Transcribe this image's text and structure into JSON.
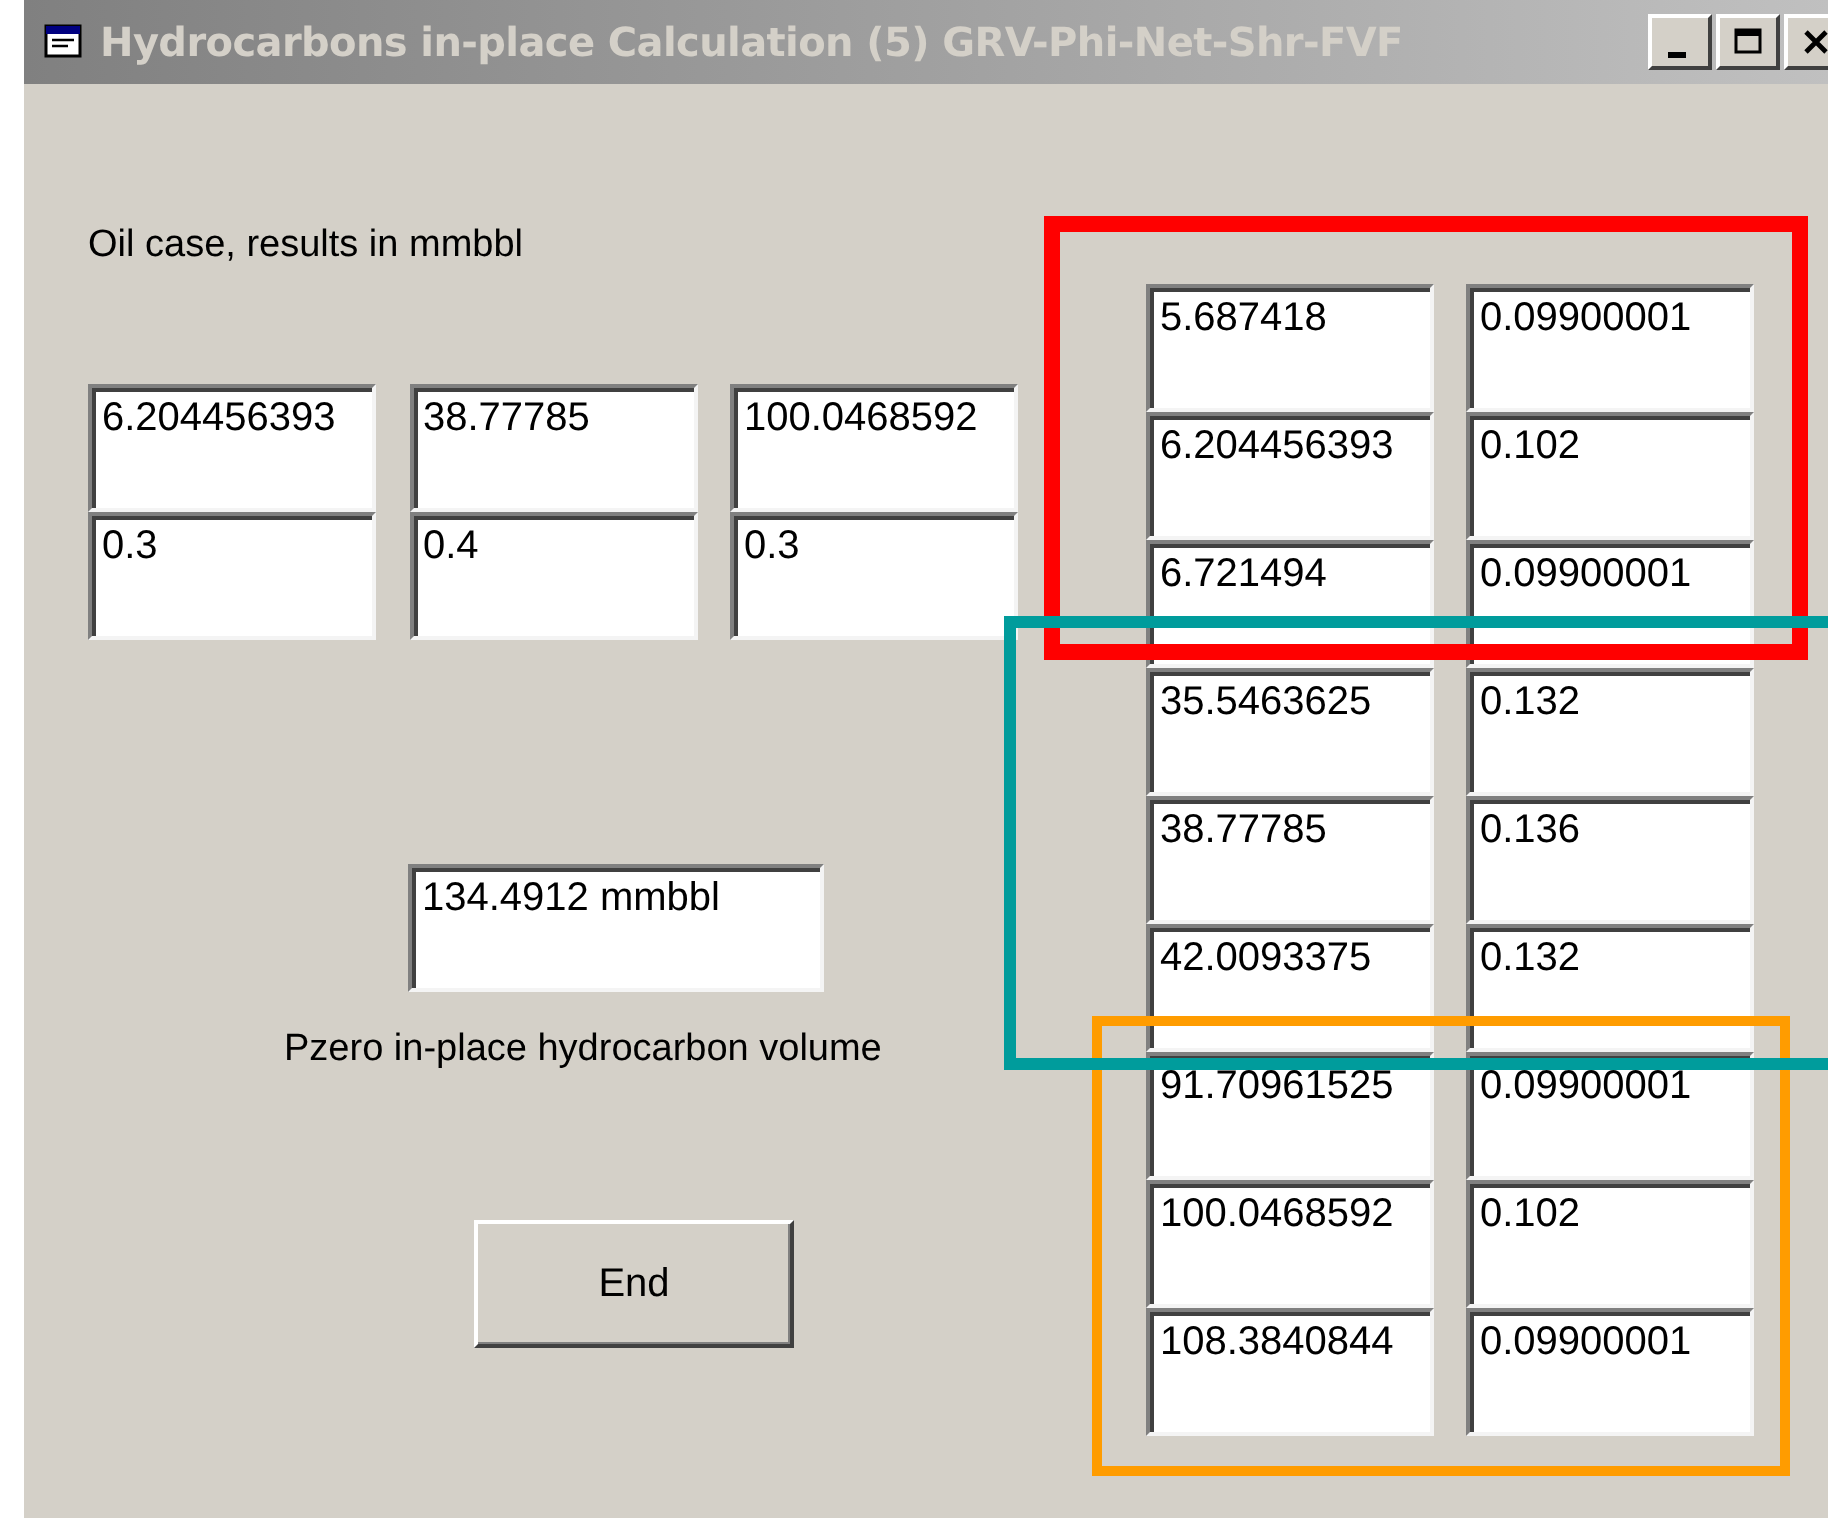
{
  "window": {
    "title": "Hydrocarbons in-place Calculation (5) GRV-Phi-Net-Shr-FVF"
  },
  "case_label": "Oil case, results in mmbbl",
  "input_grid": {
    "rows": [
      {
        "values": [
          "6.204456393",
          "38.77785",
          "100.0468592"
        ]
      },
      {
        "values": [
          "0.3",
          "0.4",
          "0.3"
        ]
      }
    ]
  },
  "result": {
    "value": "134.4912 mmbbl",
    "label": "Pzero in-place hydrocarbon volume"
  },
  "end_button": "End",
  "results_grid": {
    "rows": [
      {
        "column_1": "5.687418",
        "column_2": "0.09900001"
      },
      {
        "column_1": "6.204456393",
        "column_2": "0.102"
      },
      {
        "column_1": "6.721494",
        "column_2": "0.09900001"
      },
      {
        "column_1": "35.5463625",
        "column_2": "0.132"
      },
      {
        "column_1": "38.77785",
        "column_2": "0.136"
      },
      {
        "column_1": "42.0093375",
        "column_2": "0.132"
      },
      {
        "column_1": "91.70961525",
        "column_2": "0.09900001"
      },
      {
        "column_1": "100.0468592",
        "column_2": "0.102"
      },
      {
        "column_1": "108.3840844",
        "column_2": "0.09900001"
      }
    ]
  },
  "annotation_frames": [
    {
      "color": "#ff0000"
    },
    {
      "color": "#009c9c"
    },
    {
      "color": "#ff9c00"
    }
  ]
}
